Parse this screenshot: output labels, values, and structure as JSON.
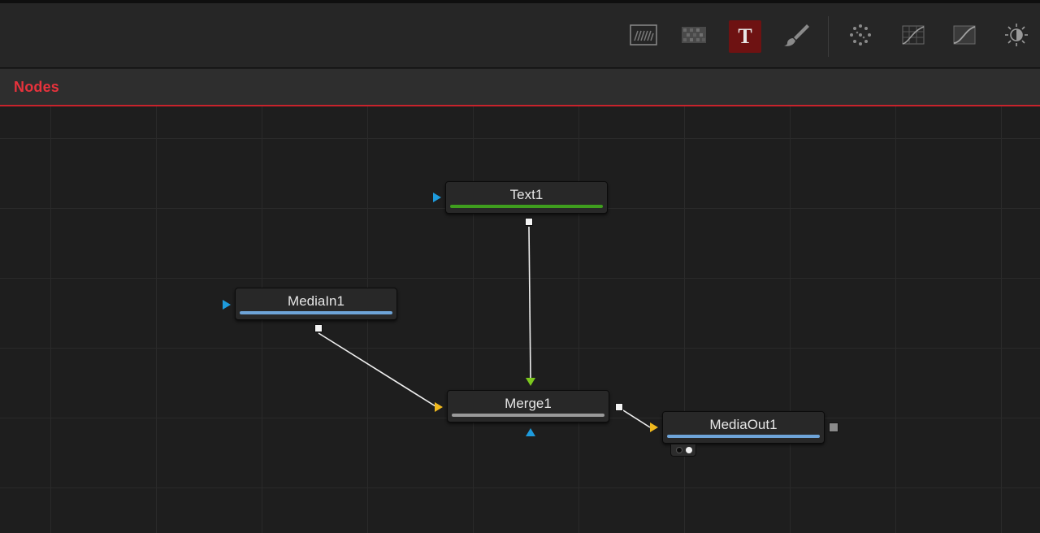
{
  "panel": {
    "title": "Nodes"
  },
  "toolbar": {
    "tools": [
      {
        "icon": "background-icon",
        "active": false
      },
      {
        "icon": "fast-noise-icon",
        "active": false
      },
      {
        "icon": "text-icon",
        "glyph": "T",
        "active": true
      },
      {
        "icon": "paint-brush-icon",
        "active": false
      },
      {
        "icon": "particles-icon",
        "active": false
      },
      {
        "icon": "color-curves-icon",
        "active": false
      },
      {
        "icon": "gamma-curve-icon",
        "active": false
      },
      {
        "icon": "brightness-contrast-icon",
        "active": false
      }
    ]
  },
  "nodes": {
    "text1": {
      "name": "Text1",
      "bar_color": "#3f9e1e"
    },
    "mediain1": {
      "name": "MediaIn1",
      "bar_color": "#6ea4d8"
    },
    "merge1": {
      "name": "Merge1",
      "bar_color": "#9a9a9a"
    },
    "mediaout1": {
      "name": "MediaOut1",
      "bar_color": "#6ea4d8"
    }
  },
  "colors": {
    "accent_red": "#e8323c",
    "active_tool_bg": "#6e1212",
    "input_blue": "#1e9bdc",
    "input_yellow": "#f0b91e",
    "input_green": "#7cc81e",
    "link_white": "#f0f0f0"
  }
}
